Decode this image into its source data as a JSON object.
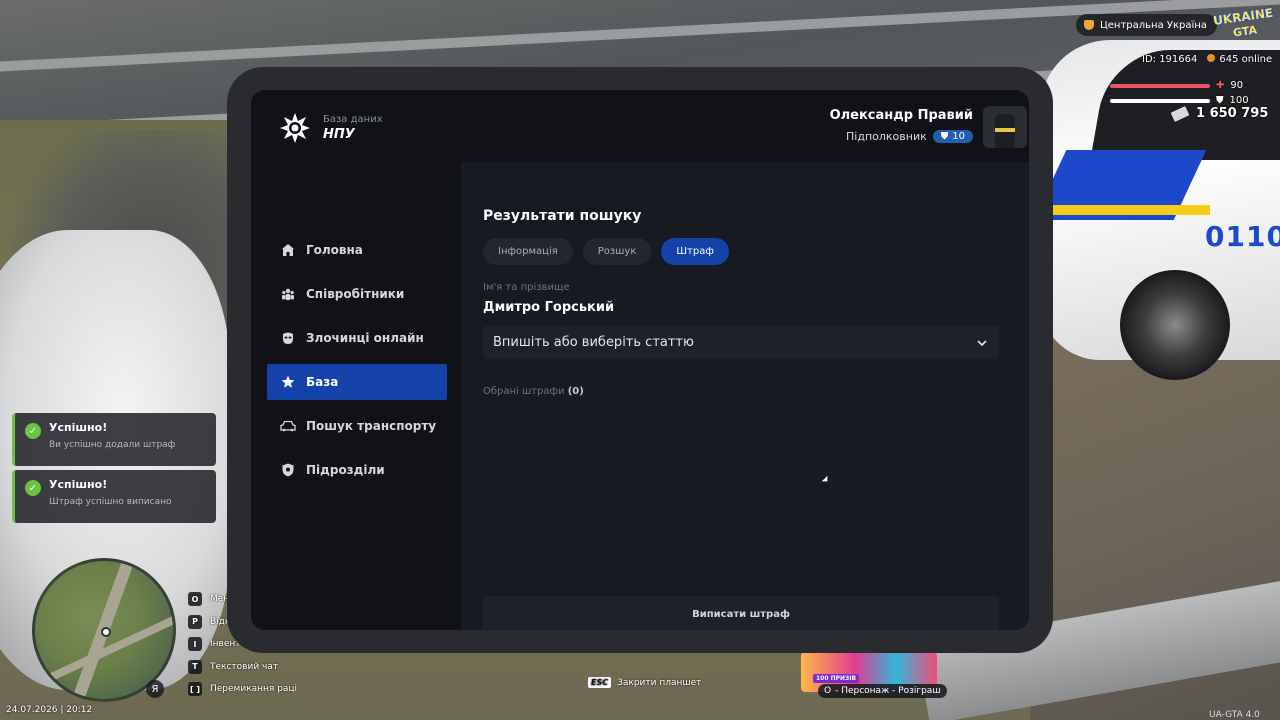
{
  "hud": {
    "region": "Центральна Україна",
    "logo_line1": "UKRAINE",
    "logo_line2": "GTA",
    "id_text": "ID: 191664",
    "online_text": "645 online",
    "health": "90",
    "armor": "100",
    "money": "1 650 795",
    "datetime": "24.07.2026 | 20:12",
    "version": "UA-GTA 4.0",
    "esc_key": "ESC",
    "esc_label": "Закрити планшет",
    "mic_key": "Я",
    "keys": [
      {
        "key": "O",
        "label": "Мен"
      },
      {
        "key": "P",
        "label": "Відк"
      },
      {
        "key": "I",
        "label": "Інвент"
      },
      {
        "key": "T",
        "label": "Текстовий чат"
      },
      {
        "key": "[  ]",
        "label": "Перемикання раці"
      }
    ],
    "promo_badge": "100 ПРИЗІВ",
    "promo_line_key": "O",
    "promo_line_label": "- Персонаж - Розіграш",
    "health_color": "#e9546a",
    "armor_color": "#ffffff",
    "car_plate": "0110"
  },
  "notifications": [
    {
      "title": "Успішно!",
      "message": "Ви успішно додали штраф"
    },
    {
      "title": "Успішно!",
      "message": "Штраф успішно виписано"
    }
  ],
  "tablet": {
    "brand": {
      "subtitle": "База даних",
      "name": "НПУ"
    },
    "user": {
      "name": "Олександр Правий",
      "rank": "Підполковник",
      "level": "10"
    },
    "nav": [
      {
        "label": "Головна",
        "icon": "home-icon"
      },
      {
        "label": "Співробітники",
        "icon": "people-icon"
      },
      {
        "label": "Злочинці онлайн",
        "icon": "mask-icon"
      },
      {
        "label": "База",
        "icon": "star-icon"
      },
      {
        "label": "Пошук транспорту",
        "icon": "car-icon"
      },
      {
        "label": "Підрозділи",
        "icon": "shield-icon"
      }
    ],
    "active_nav": "База",
    "section_title": "Результати пошуку",
    "tabs": [
      "Інформація",
      "Розшук",
      "Штраф"
    ],
    "active_tab": "Штраф",
    "name_label": "Ім'я та прізвище",
    "person_name": "Дмитро Горський",
    "article_select": {
      "placeholder": "Впишіть або виберіть статтю"
    },
    "chosen_label": "Обрані штрафи",
    "chosen_count": "(0)",
    "submit_label": "Виписати штраф",
    "accent_color": "#1442a8"
  }
}
